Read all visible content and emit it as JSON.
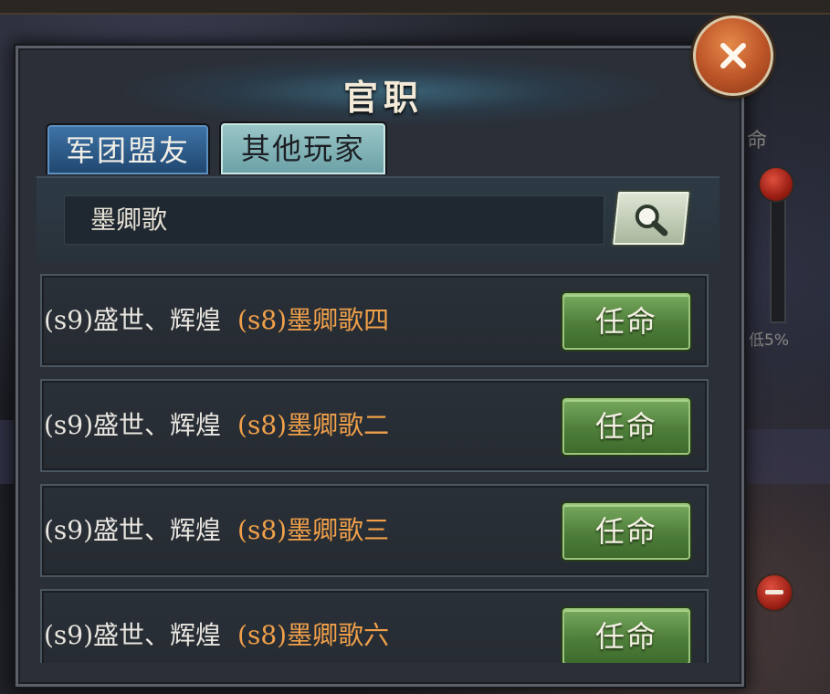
{
  "dialog": {
    "title": "官职"
  },
  "tabs": [
    {
      "label": "军团盟友",
      "active": false
    },
    {
      "label": "其他玩家",
      "active": true
    }
  ],
  "search": {
    "value": "墨卿歌",
    "icon": "search-icon"
  },
  "button_label": "任命",
  "players": [
    {
      "server_name": "(s9)盛世、辉煌",
      "player_name": "(s8)墨卿歌四"
    },
    {
      "server_name": "(s9)盛世、辉煌",
      "player_name": "(s8)墨卿歌二"
    },
    {
      "server_name": "(s9)盛世、辉煌",
      "player_name": "(s8)墨卿歌三"
    },
    {
      "server_name": "(s9)盛世、辉煌",
      "player_name": "(s8)墨卿歌六"
    }
  ],
  "background": {
    "right_label": "命",
    "percent_text": "低5%"
  },
  "colors": {
    "accent_orange": "#f0a04a",
    "button_green": "#5a8c44",
    "tab_active": "#8fbfc0",
    "tab_inactive": "#2f5f8f"
  }
}
